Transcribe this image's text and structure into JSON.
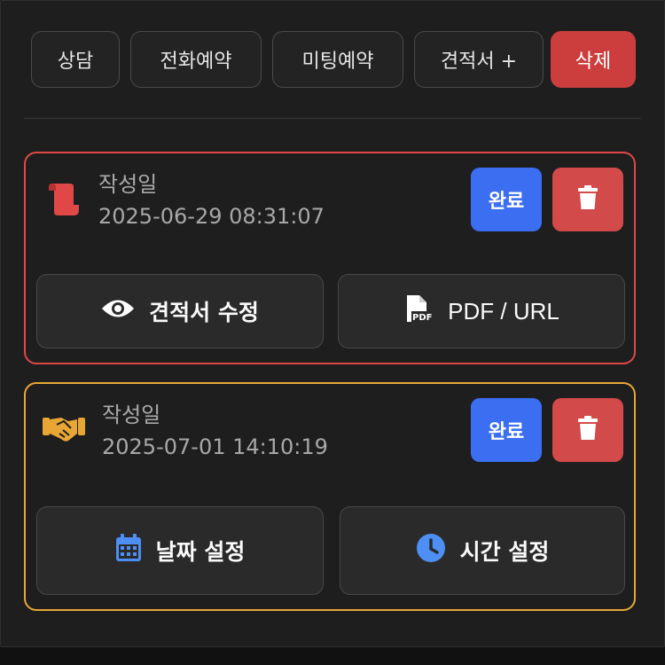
{
  "toolbar": {
    "consult": "상담",
    "phone_reservation": "전화예약",
    "meeting_reservation": "미팅예약",
    "quote_add": "견적서 +",
    "delete": "삭제"
  },
  "cards": [
    {
      "icon": "scroll-icon",
      "accent": "#e04848",
      "created_label": "작성일",
      "created_at": "2025-06-29 08:31:07",
      "done_label": "완료",
      "actions": [
        {
          "icon": "eye-icon",
          "label": "견적서 수정"
        },
        {
          "icon": "file-pdf-icon",
          "label": "PDF / URL"
        }
      ]
    },
    {
      "icon": "handshake-icon",
      "accent": "#e8a735",
      "created_label": "작성일",
      "created_at": "2025-07-01 14:10:19",
      "done_label": "완료",
      "actions": [
        {
          "icon": "calendar-icon",
          "label": "날짜 설정"
        },
        {
          "icon": "clock-icon",
          "label": "시간 설정"
        }
      ]
    }
  ],
  "colors": {
    "primary": "#3b6ef0",
    "danger": "#d24a4a",
    "info_blue": "#4d8ff5"
  }
}
